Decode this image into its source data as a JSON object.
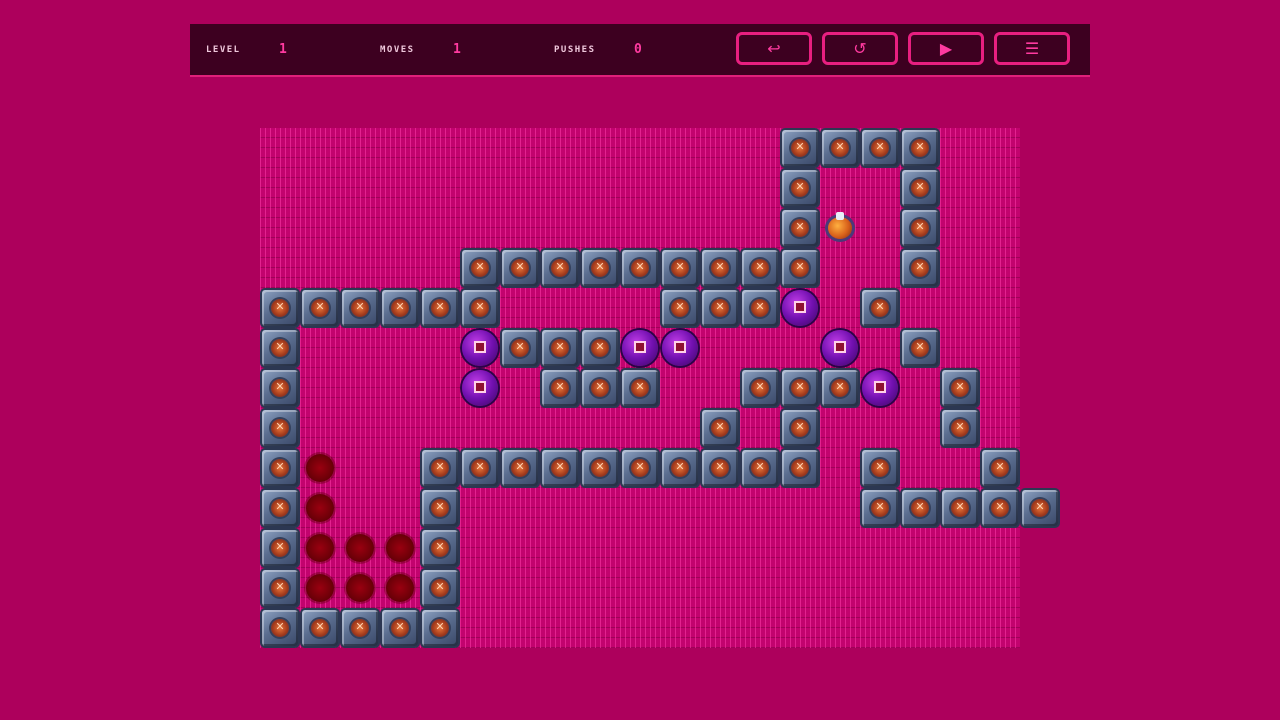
{
  "hud": {
    "level_label": "LEVEL",
    "level_value": "1",
    "moves_label": "MOVES",
    "moves_value": "1",
    "pushes_label": "PUSHES",
    "pushes_value": "0",
    "buttons": [
      {
        "name": "undo",
        "icon": "undo-arrow-icon",
        "glyph": "↩"
      },
      {
        "name": "restart",
        "icon": "restart-icon",
        "glyph": "↺"
      },
      {
        "name": "play",
        "icon": "play-icon",
        "glyph": "▶"
      },
      {
        "name": "menu",
        "icon": "hamburger-menu-icon",
        "glyph": "☰"
      }
    ]
  },
  "colors": {
    "background": "#ad005c",
    "hud_background": "#3d0020",
    "accent": "#e81f80",
    "wall": "#5a6d8f",
    "box": "#7210b0",
    "goal": "#8a0010",
    "player": "#d8601a"
  },
  "board": {
    "legend": {
      "#": "wall",
      " ": "floor",
      ".": "goal",
      "$": "box",
      "@": "player",
      "_": "outside"
    },
    "rows": [
      "_____________####",
      "_____________#  #",
      "_____________#@ #",
      "_____#########  #",
      "######    ###$ #",
      "#    $###$$   $ #",
      "#    $ ###  ###$ #",
      "#          # #   #",
      "#.  ########## #  #",
      "#.  #          #####",
      "#...#",
      "#...#",
      "#####"
    ]
  }
}
